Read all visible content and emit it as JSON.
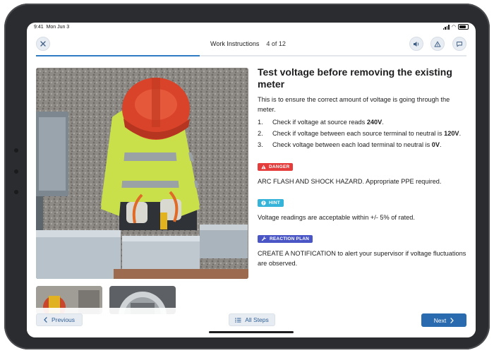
{
  "status": {
    "time": "9:41",
    "date": "Mon Jun 3"
  },
  "header": {
    "title": "Work Instructions",
    "step_indicator": "4 of 12",
    "progress": 0.38,
    "icons": {
      "close": "close-icon",
      "speaker": "speaker-icon",
      "warning": "warning-icon",
      "chat": "chat-icon"
    }
  },
  "instruction": {
    "title": "Test voltage before removing the existing meter",
    "description": "This is to ensure the correct amount of voltage is going through the meter.",
    "steps": [
      {
        "num": "1.",
        "text": "Check if voltage at source reads ",
        "bold": "240V",
        "after": "."
      },
      {
        "num": "2.",
        "text": "Check if voltage between each source terminal to neutral is ",
        "bold": "120V",
        "after": "."
      },
      {
        "num": "3.",
        "text": "Check voltage between each load terminal to neutral is ",
        "bold": "0V",
        "after": "."
      }
    ]
  },
  "danger": {
    "label": "DANGER",
    "text": "ARC FLASH AND SHOCK HAZARD. Appropriate PPE required."
  },
  "hint": {
    "label": "HINT",
    "text": "Voltage readings are acceptable within +/- 5% of rated."
  },
  "reaction": {
    "label": "REACTION PLAN",
    "text": "CREATE A NOTIFICATION to alert your supervisor if voltage fluctuations are observed."
  },
  "footer": {
    "previous": "Previous",
    "all_steps": "All Steps",
    "next": "Next"
  },
  "colors": {
    "accent": "#2a6bb0",
    "danger": "#e53c3c",
    "hint": "#36b3d9",
    "reaction": "#4a56c6"
  }
}
